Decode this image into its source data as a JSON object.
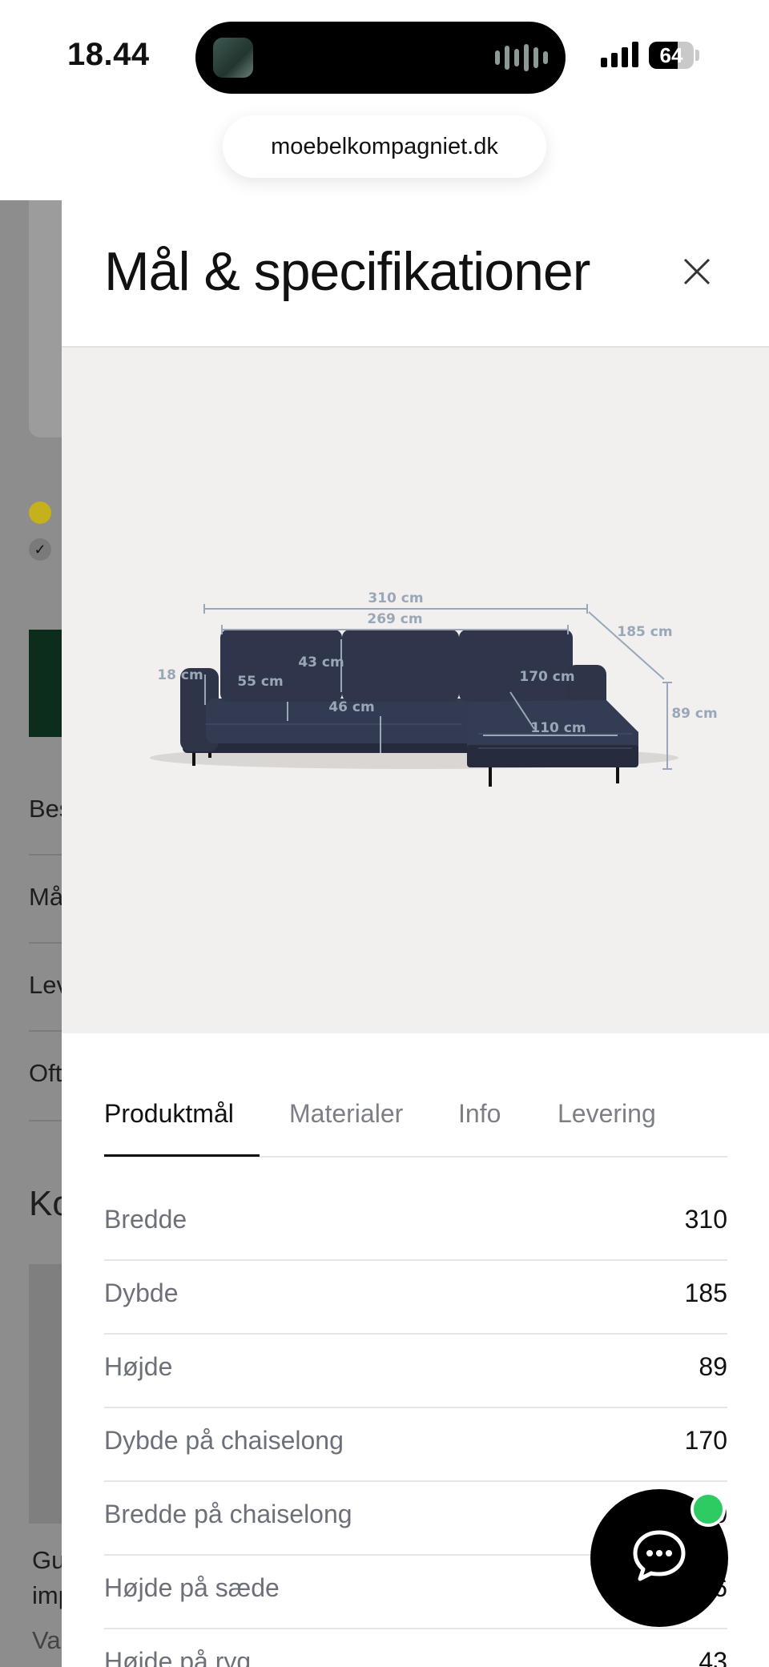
{
  "status_bar": {
    "time": "18.44",
    "battery": "64",
    "battery_level": 0.64
  },
  "browser": {
    "url": "moebelkompagniet.dk"
  },
  "background_page": {
    "rows": [
      "Bes",
      "Må",
      "Lev",
      "Oft"
    ],
    "heading": "Ko",
    "card_text": [
      "Gu",
      "imp",
      "Va"
    ]
  },
  "drawer": {
    "title": "Mål & specifikationer",
    "close_icon": "close-icon",
    "diagram_labels": {
      "total_width": "310 cm",
      "back_width": "269 cm",
      "depth": "185 cm",
      "back_height": "43 cm",
      "arm_height": "18 cm",
      "seat_depth": "55 cm",
      "seat_height": "46 cm",
      "chaise_depth": "170 cm",
      "height": "89 cm",
      "chaise_width": "110 cm"
    },
    "tabs": [
      {
        "label": "Produktmål",
        "active": true
      },
      {
        "label": "Materialer",
        "active": false
      },
      {
        "label": "Info",
        "active": false
      },
      {
        "label": "Levering",
        "active": false
      }
    ],
    "specs": [
      {
        "label": "Bredde",
        "value": "310"
      },
      {
        "label": "Dybde",
        "value": "185"
      },
      {
        "label": "Højde",
        "value": "89"
      },
      {
        "label": "Dybde på chaiselong",
        "value": "170"
      },
      {
        "label": "Bredde på chaiselong",
        "value": "0"
      },
      {
        "label": "Højde på sæde",
        "value": "6"
      },
      {
        "label": "Højde på ryg",
        "value": "43"
      }
    ]
  },
  "chat": {
    "icon": "chat-bubble-icon",
    "online_color": "#2ecb62"
  }
}
